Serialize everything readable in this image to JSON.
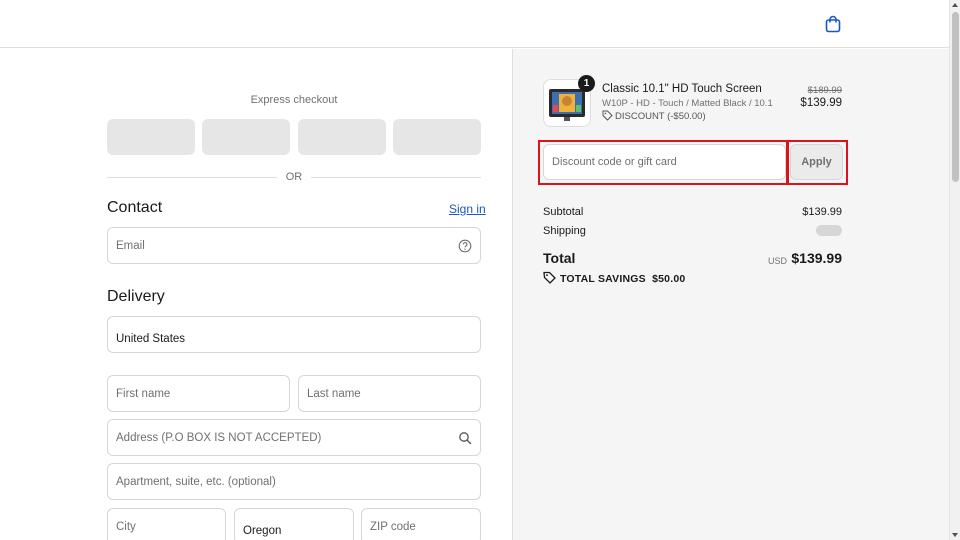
{
  "express": {
    "label": "Express checkout",
    "or": "OR"
  },
  "contact": {
    "title": "Contact",
    "signin": "Sign in",
    "email_placeholder": "Email"
  },
  "delivery": {
    "title": "Delivery",
    "country": "United States",
    "first_name_placeholder": "First name",
    "last_name_placeholder": "Last name",
    "address_placeholder": "Address (P.O BOX IS NOT ACCEPTED)",
    "apartment_placeholder": "Apartment, suite, etc. (optional)",
    "city_placeholder": "City",
    "state": "Oregon",
    "zip_placeholder": "ZIP code"
  },
  "cart": {
    "item": {
      "quantity": "1",
      "title": "Classic 10.1\" HD Touch Screen",
      "variant": "W10P - HD - Touch / Matted Black / 10.1",
      "discount": "DISCOUNT (-$50.00)",
      "original_price": "$189.99",
      "price": "$139.99"
    },
    "discount_placeholder": "Discount code or gift card",
    "apply_label": "Apply",
    "subtotal_label": "Subtotal",
    "subtotal": "$139.99",
    "shipping_label": "Shipping",
    "total_label": "Total",
    "currency": "USD",
    "total": "$139.99",
    "savings_label": "TOTAL SAVINGS",
    "savings": "$50.00"
  },
  "colors": {
    "link": "#1a56c4",
    "highlight": "#d9141c",
    "panel_bg": "#f5f5f5"
  },
  "icons": [
    "shopping-bag-icon",
    "question-circle-icon",
    "search-icon",
    "tag-icon"
  ]
}
